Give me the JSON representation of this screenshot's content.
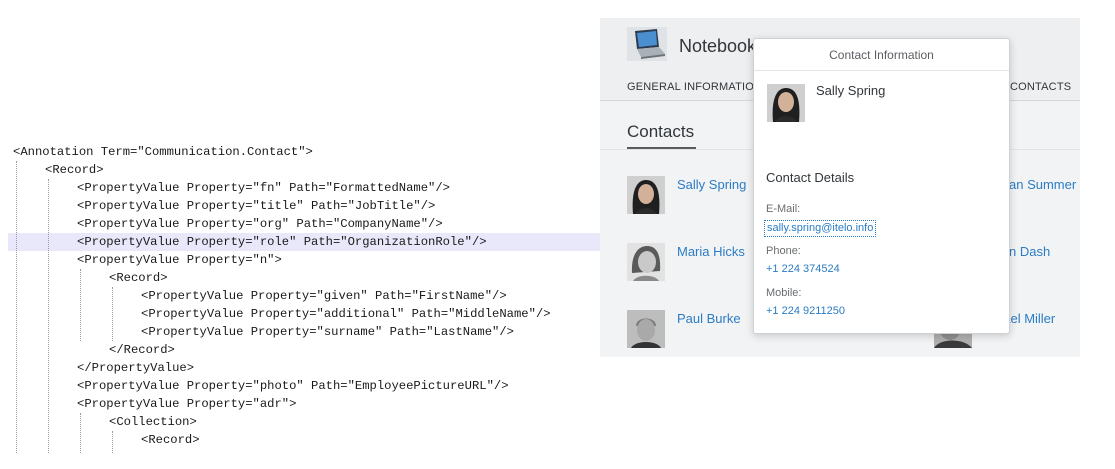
{
  "code": {
    "lines": [
      "<Annotation Term=\"Communication.Contact\">",
      "<Record>",
      "<PropertyValue Property=\"fn\" Path=\"FormattedName\"/>",
      "<PropertyValue Property=\"title\" Path=\"JobTitle\"/>",
      "<PropertyValue Property=\"org\" Path=\"CompanyName\"/>",
      "<PropertyValue Property=\"role\" Path=\"OrganizationRole\"/>",
      "<PropertyValue Property=\"n\">",
      "<Record>",
      "<PropertyValue Property=\"given\" Path=\"FirstName\"/>",
      "<PropertyValue Property=\"additional\" Path=\"MiddleName\"/>",
      "<PropertyValue Property=\"surname\" Path=\"LastName\"/>",
      "</Record>",
      "</PropertyValue>",
      "<PropertyValue Property=\"photo\" Path=\"EmployeePictureURL\"/>",
      "<PropertyValue Property=\"adr\">",
      "<Collection>",
      "<Record>"
    ]
  },
  "app": {
    "title": "Notebook",
    "tab_left": "GENERAL INFORMATIO",
    "tab_right": "CONTACTS",
    "section_title": "Contacts",
    "contacts_left": [
      "Sally Spring",
      "Maria Hicks",
      "Paul Burke"
    ],
    "contacts_right": [
      "an Summer",
      "n Dash",
      "hael Miller"
    ]
  },
  "popover": {
    "title": "Contact Information",
    "name": "Sally Spring",
    "section": "Contact Details",
    "email_label": "E-Mail:",
    "email": "sally.spring@itelo.info",
    "phone_label": "Phone:",
    "phone": "+1 224 374524",
    "mobile_label": "Mobile:",
    "mobile": "+1 224 9211250"
  },
  "colors": {
    "link": "#2b7cc4",
    "highlight_line": "#e8e8fa",
    "app_background": "#f2f3f4"
  }
}
